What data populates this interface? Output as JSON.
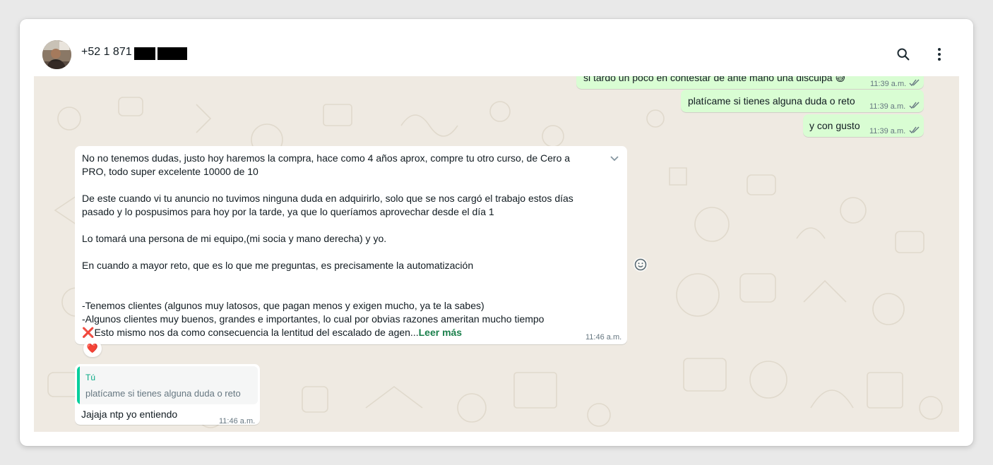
{
  "header": {
    "contact_name": "+52 1 871",
    "icons": [
      "search-icon",
      "more-vert-icon"
    ]
  },
  "messages": [
    {
      "direction": "out",
      "text": "si tardo un poco en contestar de ante mano una disculpa 😅",
      "time": "11:39 a.m.",
      "status": "read"
    },
    {
      "direction": "out",
      "text": "platícame si tienes alguna duda o reto",
      "time": "11:39 a.m.",
      "status": "read"
    },
    {
      "direction": "out",
      "text": "y con gusto",
      "time": "11:39 a.m.",
      "status": "read"
    },
    {
      "direction": "in",
      "lines": [
        "No no tenemos dudas, justo hoy haremos la compra, hace como 4 años aprox, compre tu otro curso, de Cero a",
        "PRO, todo super excelente 10000 de 10",
        "De este cuando vi tu anuncio no tuvimos ninguna duda en adquirirlo, solo que se nos cargó el trabajo estos días",
        "pasado y lo  pospusimos para hoy por la tarde, ya que lo queríamos aprovechar desde el día 1",
        "Lo tomará una persona de mi equipo,(mi socia y mano derecha) y yo.",
        "En cuando a mayor reto, que es lo que me preguntas, es precisamente la automatización",
        "-Tenemos clientes (algunos muy latosos, que pagan menos y exigen mucho, ya te la sabes)",
        "-Algunos clientes muy buenos, grandes e importantes, lo cual por obvias razones ameritan mucho tiempo",
        "Esto mismo nos da como consecuencia la lentitud del escalado de agen..."
      ],
      "x_emoji": "❌",
      "read_more": "Leer más",
      "time": "11:46 a.m.",
      "reaction": "❤️"
    },
    {
      "direction": "in",
      "quote_author": "Tú",
      "quote_text": "platícame si tienes alguna duda o reto",
      "text": "Jajaja ntp yo entiendo",
      "time": "11:46 a.m."
    }
  ],
  "colors": {
    "outgoing_bubble": "#d9fdd3",
    "incoming_bubble": "#ffffff",
    "chat_background": "#efeae2",
    "read_ticks": "#53bdeb",
    "quote_accent": "#06cf9c",
    "read_more": "#1a7f4b"
  }
}
